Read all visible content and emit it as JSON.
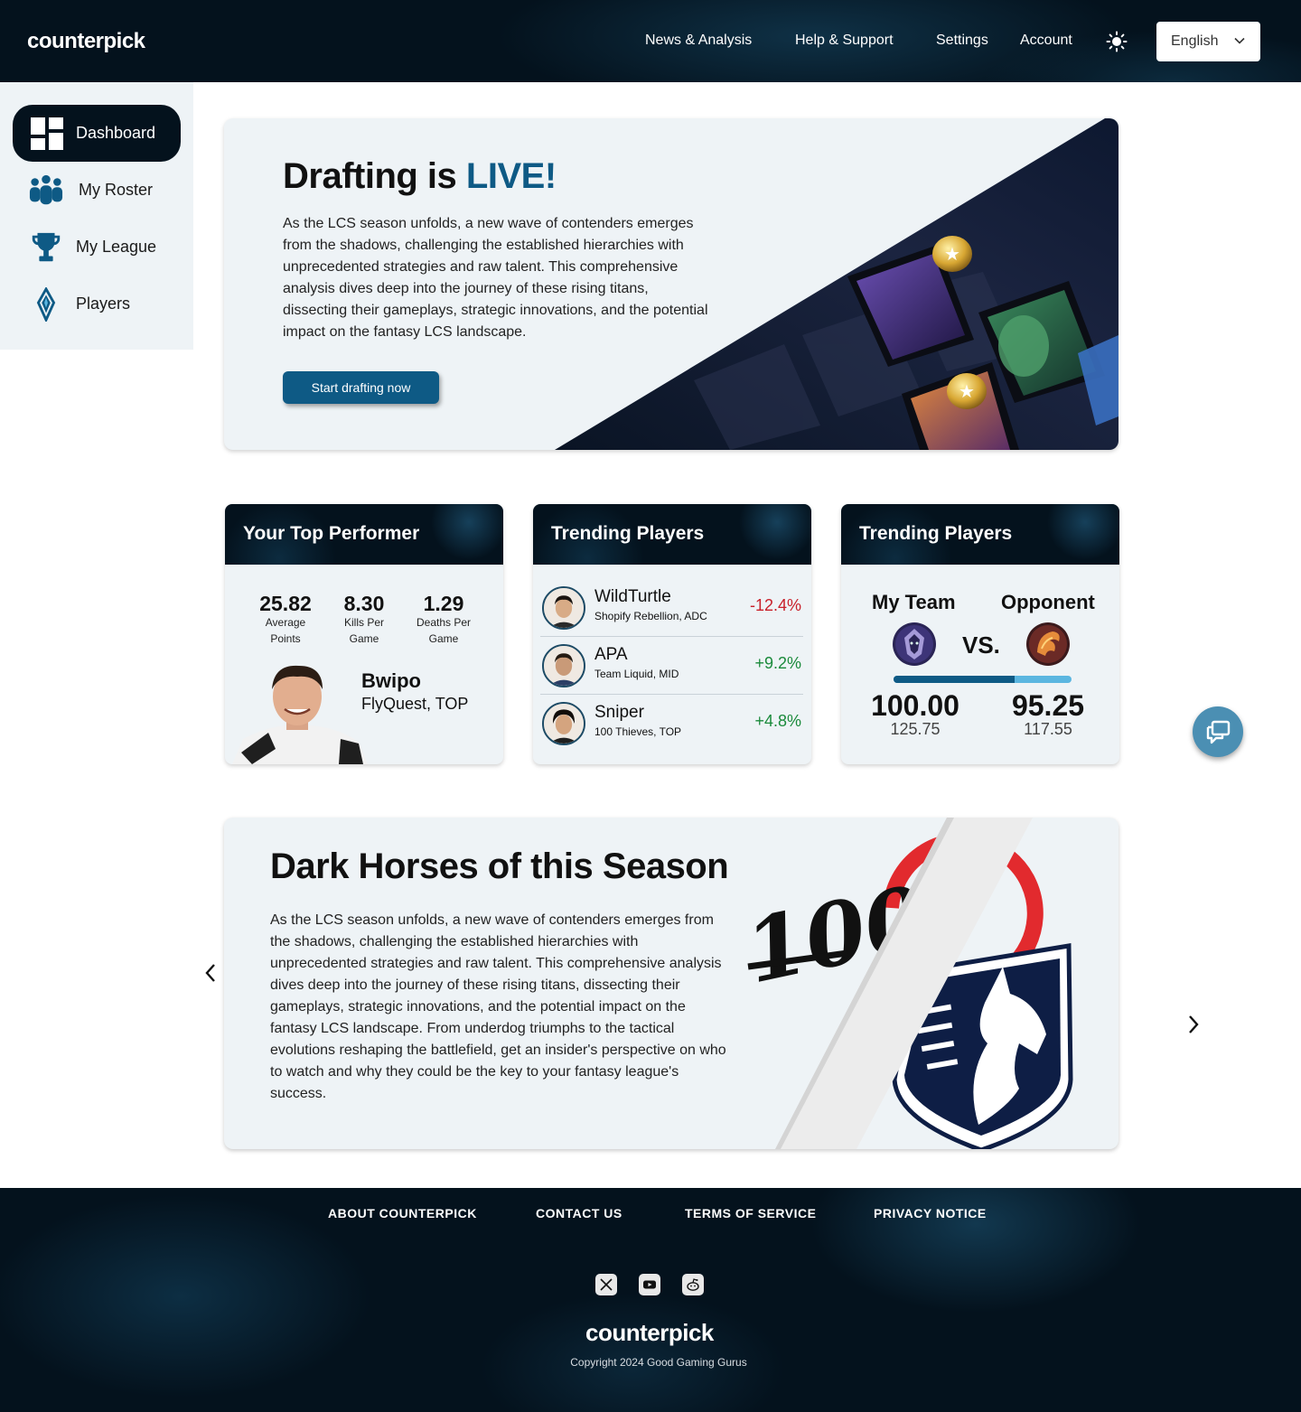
{
  "header": {
    "logo": "counterpick",
    "nav": [
      "News & Analysis",
      "Help & Support",
      "Settings",
      "Account"
    ],
    "theme_icon": "sun-icon",
    "language": "English"
  },
  "sidebar": {
    "items": [
      {
        "label": "Dashboard",
        "icon": "dashboard-icon",
        "active": true
      },
      {
        "label": "My Roster",
        "icon": "people-icon",
        "active": false
      },
      {
        "label": "My League",
        "icon": "trophy-icon",
        "active": false
      },
      {
        "label": "Players",
        "icon": "players-crest-icon",
        "active": false
      }
    ]
  },
  "hero": {
    "title_prefix": "Drafting is",
    "title_highlight": "LIVE!",
    "body": "As the LCS season unfolds, a new wave of contenders emerges from the shadows, challenging the established hierarchies with unprecedented strategies and raw talent. This comprehensive analysis dives deep into the journey of these rising titans, dissecting their gameplays, strategic innovations, and the potential impact on the fantasy LCS landscape.",
    "button": "Start drafting now"
  },
  "top_performer": {
    "title": "Your Top Performer",
    "stats": [
      {
        "value": "25.82",
        "caption_1": "Average",
        "caption_2": "Points"
      },
      {
        "value": "8.30",
        "caption_1": "Kills Per",
        "caption_2": "Game"
      },
      {
        "value": "1.29",
        "caption_1": "Deaths Per",
        "caption_2": "Game"
      }
    ],
    "name": "Bwipo",
    "team": "FlyQuest, TOP"
  },
  "trending": {
    "title": "Trending Players",
    "players": [
      {
        "name": "WildTurtle",
        "team": "Shopify Rebellion, ADC",
        "change": "-12.4%",
        "direction": "down"
      },
      {
        "name": "APA",
        "team": "Team Liquid, MID",
        "change": "+9.2%",
        "direction": "up"
      },
      {
        "name": "Sniper",
        "team": "100 Thieves, TOP",
        "change": "+4.8%",
        "direction": "up"
      }
    ]
  },
  "matchup": {
    "title": "Trending Players",
    "my_team_label": "My Team",
    "opponent_label": "Opponent",
    "vs": "VS.",
    "my_score": "100.00",
    "my_projected": "125.75",
    "opp_score": "95.25",
    "opp_projected": "117.55",
    "bar_fraction": 0.68
  },
  "dark_horses": {
    "title": "Dark Horses of this Season",
    "body": "As the LCS season unfolds, a new wave of contenders emerges from the shadows, challenging the established hierarchies with unprecedented strategies and raw talent. This comprehensive analysis dives deep into the journey of these rising titans, dissecting their gameplays, strategic innovations, and the potential impact on the fantasy LCS landscape. From underdog triumphs to the tactical evolutions reshaping the battlefield, get an insider's perspective on who to watch and why they could be the key to your fantasy league's success.",
    "logo_text": "100"
  },
  "footer": {
    "links": [
      "ABOUT COUNTERPICK",
      "CONTACT US",
      "TERMS OF SERVICE",
      "PRIVACY NOTICE"
    ],
    "social": [
      "x-icon",
      "youtube-icon",
      "reddit-icon"
    ],
    "logo": "counterpick",
    "copyright": "Copyright 2024 Good Gaming Gurus"
  },
  "colors": {
    "brand": "#0e5a85",
    "dark": "#04121d",
    "panel": "#eef3f6",
    "negative": "#c8202a",
    "positive": "#1a8a3b"
  }
}
